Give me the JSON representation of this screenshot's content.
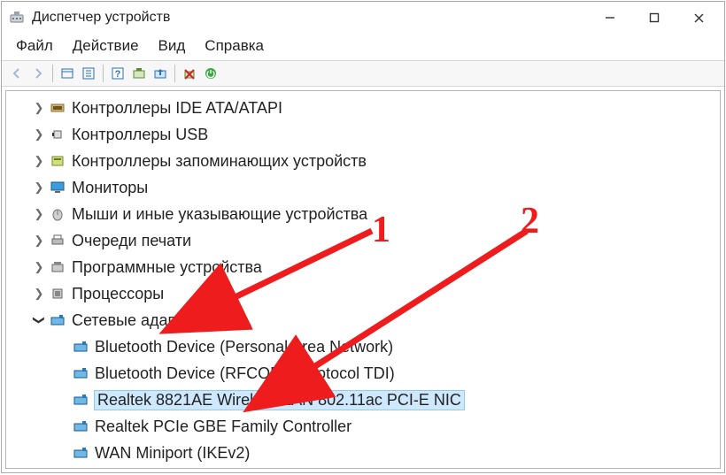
{
  "window": {
    "title": "Диспетчер устройств"
  },
  "menu": {
    "file": "Файл",
    "action": "Действие",
    "view": "Вид",
    "help": "Справка"
  },
  "tree": {
    "items": [
      {
        "label": "Контроллеры IDE ATA/ATAPI",
        "icon": "ide"
      },
      {
        "label": "Контроллеры USB",
        "icon": "usb"
      },
      {
        "label": "Контроллеры запоминающих устройств",
        "icon": "storage"
      },
      {
        "label": "Мониторы",
        "icon": "monitor"
      },
      {
        "label": "Мыши и иные указывающие устройства",
        "icon": "mouse"
      },
      {
        "label": "Очереди печати",
        "icon": "printer"
      },
      {
        "label": "Программные устройства",
        "icon": "software"
      },
      {
        "label": "Процессоры",
        "icon": "cpu"
      }
    ],
    "expanded": {
      "label": "Сетевые адаптеры",
      "icon": "network",
      "children": [
        {
          "label": "Bluetooth Device (Personal Area Network)"
        },
        {
          "label": "Bluetooth Device (RFCOMM Protocol TDI)"
        },
        {
          "label": "Realtek 8821AE Wireless LAN 802.11ac PCI-E NIC",
          "selected": true
        },
        {
          "label": "Realtek PCIe GBE Family Controller"
        },
        {
          "label": "WAN Miniport (IKEv2)"
        }
      ]
    }
  },
  "annotations": {
    "one": "1",
    "two": "2"
  }
}
